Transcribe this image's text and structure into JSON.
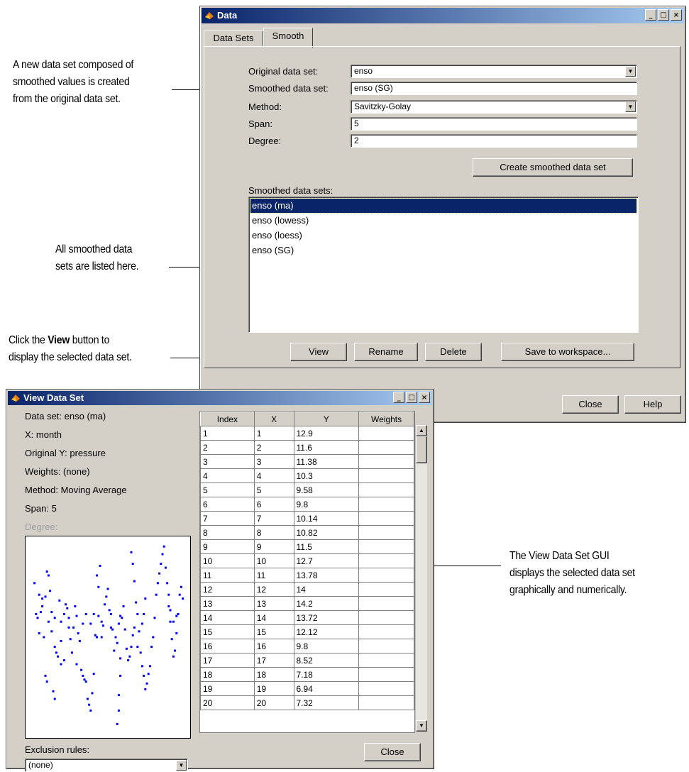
{
  "annotations": {
    "a1": [
      "A new data set composed of",
      "smoothed values is created",
      "from the original data set."
    ],
    "a2": [
      "All smoothed data",
      "sets are listed here."
    ],
    "a3_line1_pre": "Click the ",
    "a3_line1_bold": "View",
    "a3_line1_post": " button to",
    "a3_line2": "display the selected data set.",
    "a4": [
      "The View Data Set GUI",
      "displays the selected data set",
      "graphically and numerically."
    ]
  },
  "data_window": {
    "title": "Data",
    "tabs": [
      "Data Sets",
      "Smooth"
    ],
    "active_tab": "Smooth",
    "form": {
      "original_label": "Original data set:",
      "original_value": "enso",
      "smoothed_label": "Smoothed data set:",
      "smoothed_value": "enso (SG)",
      "method_label": "Method:",
      "method_value": "Savitzky-Golay",
      "span_label": "Span:",
      "span_value": "5",
      "degree_label": "Degree:",
      "degree_value": "2"
    },
    "create_button": "Create smoothed data set",
    "list_label": "Smoothed data sets:",
    "list_items": [
      "enso (ma)",
      "enso (lowess)",
      "enso (loess)",
      "enso (SG)"
    ],
    "selected_index": 0,
    "buttons": {
      "view": "View",
      "rename": "Rename",
      "delete": "Delete",
      "save": "Save to workspace..."
    },
    "close": "Close",
    "help": "Help"
  },
  "view_window": {
    "title": "View Data Set",
    "info": {
      "dataset": "Data set: enso (ma)",
      "x": "X: month",
      "y": "Original Y:  pressure",
      "weights": "Weights: (none)",
      "method": "Method:  Moving Average",
      "span": "Span:  5",
      "degree": "Degree:"
    },
    "exclusion_label": "Exclusion rules:",
    "exclusion_value": "(none)",
    "columns": [
      "Index",
      "X",
      "Y",
      "Weights"
    ],
    "rows": [
      [
        "1",
        "1",
        "12.9",
        ""
      ],
      [
        "2",
        "2",
        "11.6",
        ""
      ],
      [
        "3",
        "3",
        "11.38",
        ""
      ],
      [
        "4",
        "4",
        "10.3",
        ""
      ],
      [
        "5",
        "5",
        "9.58",
        ""
      ],
      [
        "6",
        "6",
        "9.8",
        ""
      ],
      [
        "7",
        "7",
        "10.14",
        ""
      ],
      [
        "8",
        "8",
        "10.82",
        ""
      ],
      [
        "9",
        "9",
        "11.5",
        ""
      ],
      [
        "10",
        "10",
        "12.7",
        ""
      ],
      [
        "11",
        "11",
        "13.78",
        ""
      ],
      [
        "12",
        "12",
        "14",
        ""
      ],
      [
        "13",
        "13",
        "14.2",
        ""
      ],
      [
        "14",
        "14",
        "13.72",
        ""
      ],
      [
        "15",
        "15",
        "12.12",
        ""
      ],
      [
        "16",
        "16",
        "9.8",
        ""
      ],
      [
        "17",
        "17",
        "8.52",
        ""
      ],
      [
        "18",
        "18",
        "7.18",
        ""
      ],
      [
        "19",
        "19",
        "6.94",
        ""
      ],
      [
        "20",
        "20",
        "7.32",
        ""
      ]
    ],
    "close": "Close",
    "plot_color": "#0000ff",
    "plot_points": [
      [
        0.03,
        0.78
      ],
      [
        0.06,
        0.72
      ],
      [
        0.07,
        0.63
      ],
      [
        0.08,
        0.66
      ],
      [
        0.1,
        0.71
      ],
      [
        0.11,
        0.84
      ],
      [
        0.12,
        0.82
      ],
      [
        0.13,
        0.74
      ],
      [
        0.14,
        0.63
      ],
      [
        0.14,
        0.53
      ],
      [
        0.16,
        0.6
      ],
      [
        0.16,
        0.45
      ],
      [
        0.17,
        0.42
      ],
      [
        0.19,
        0.69
      ],
      [
        0.2,
        0.58
      ],
      [
        0.2,
        0.48
      ],
      [
        0.22,
        0.62
      ],
      [
        0.23,
        0.67
      ],
      [
        0.24,
        0.65
      ],
      [
        0.25,
        0.6
      ],
      [
        0.25,
        0.55
      ],
      [
        0.26,
        0.49
      ],
      [
        0.28,
        0.55
      ],
      [
        0.29,
        0.66
      ],
      [
        0.3,
        0.61
      ],
      [
        0.31,
        0.52
      ],
      [
        0.32,
        0.48
      ],
      [
        0.33,
        0.33
      ],
      [
        0.34,
        0.3
      ],
      [
        0.35,
        0.28
      ],
      [
        0.36,
        0.27
      ],
      [
        0.37,
        0.18
      ],
      [
        0.38,
        0.15
      ],
      [
        0.39,
        0.12
      ],
      [
        0.4,
        0.21
      ],
      [
        0.41,
        0.31
      ],
      [
        0.42,
        0.51
      ],
      [
        0.43,
        0.5
      ],
      [
        0.44,
        0.61
      ],
      [
        0.46,
        0.58
      ],
      [
        0.47,
        0.56
      ],
      [
        0.48,
        0.67
      ],
      [
        0.49,
        0.71
      ],
      [
        0.5,
        0.75
      ],
      [
        0.51,
        0.64
      ],
      [
        0.52,
        0.55
      ],
      [
        0.53,
        0.54
      ],
      [
        0.54,
        0.43
      ],
      [
        0.55,
        0.5
      ],
      [
        0.56,
        0.47
      ],
      [
        0.57,
        0.57
      ],
      [
        0.58,
        0.61
      ],
      [
        0.59,
        0.6
      ],
      [
        0.6,
        0.66
      ],
      [
        0.61,
        0.54
      ],
      [
        0.62,
        0.44
      ],
      [
        0.63,
        0.38
      ],
      [
        0.64,
        0.4
      ],
      [
        0.65,
        0.45
      ],
      [
        0.66,
        0.51
      ],
      [
        0.67,
        0.55
      ],
      [
        0.68,
        0.68
      ],
      [
        0.69,
        0.62
      ],
      [
        0.7,
        0.53
      ],
      [
        0.71,
        0.42
      ],
      [
        0.72,
        0.35
      ],
      [
        0.73,
        0.3
      ],
      [
        0.74,
        0.23
      ],
      [
        0.75,
        0.26
      ],
      [
        0.76,
        0.31
      ],
      [
        0.77,
        0.35
      ],
      [
        0.78,
        0.45
      ],
      [
        0.79,
        0.5
      ],
      [
        0.8,
        0.6
      ],
      [
        0.81,
        0.72
      ],
      [
        0.82,
        0.78
      ],
      [
        0.83,
        0.83
      ],
      [
        0.84,
        0.88
      ],
      [
        0.85,
        0.93
      ],
      [
        0.86,
        0.97
      ],
      [
        0.87,
        0.86
      ],
      [
        0.88,
        0.78
      ],
      [
        0.89,
        0.66
      ],
      [
        0.9,
        0.58
      ],
      [
        0.91,
        0.49
      ],
      [
        0.92,
        0.4
      ],
      [
        0.93,
        0.43
      ],
      [
        0.94,
        0.52
      ],
      [
        0.95,
        0.62
      ],
      [
        0.96,
        0.72
      ],
      [
        0.97,
        0.76
      ],
      [
        0.98,
        0.7
      ],
      [
        0.52,
        0.62
      ],
      [
        0.46,
        0.5
      ],
      [
        0.18,
        0.4
      ],
      [
        0.22,
        0.38
      ],
      [
        0.06,
        0.52
      ],
      [
        0.05,
        0.6
      ],
      [
        0.09,
        0.5
      ],
      [
        0.12,
        0.58
      ],
      [
        0.27,
        0.42
      ],
      [
        0.3,
        0.36
      ],
      [
        0.15,
        0.22
      ],
      [
        0.16,
        0.18
      ],
      [
        0.1,
        0.3
      ],
      [
        0.11,
        0.27
      ],
      [
        0.2,
        0.36
      ],
      [
        0.58,
        0.3
      ],
      [
        0.57,
        0.2
      ],
      [
        0.57,
        0.12
      ],
      [
        0.56,
        0.05
      ],
      [
        0.58,
        0.39
      ],
      [
        0.74,
        0.7
      ],
      [
        0.73,
        0.62
      ],
      [
        0.72,
        0.57
      ],
      [
        0.69,
        0.45
      ],
      [
        0.65,
        0.94
      ],
      [
        0.66,
        0.88
      ],
      [
        0.67,
        0.79
      ],
      [
        0.45,
        0.87
      ],
      [
        0.44,
        0.76
      ],
      [
        0.43,
        0.82
      ],
      [
        0.89,
        0.72
      ],
      [
        0.9,
        0.64
      ],
      [
        0.92,
        0.58
      ],
      [
        0.94,
        0.61
      ],
      [
        0.36,
        0.62
      ],
      [
        0.34,
        0.57
      ],
      [
        0.41,
        0.62
      ],
      [
        0.39,
        0.57
      ],
      [
        0.08,
        0.7
      ],
      [
        0.04,
        0.62
      ]
    ]
  }
}
